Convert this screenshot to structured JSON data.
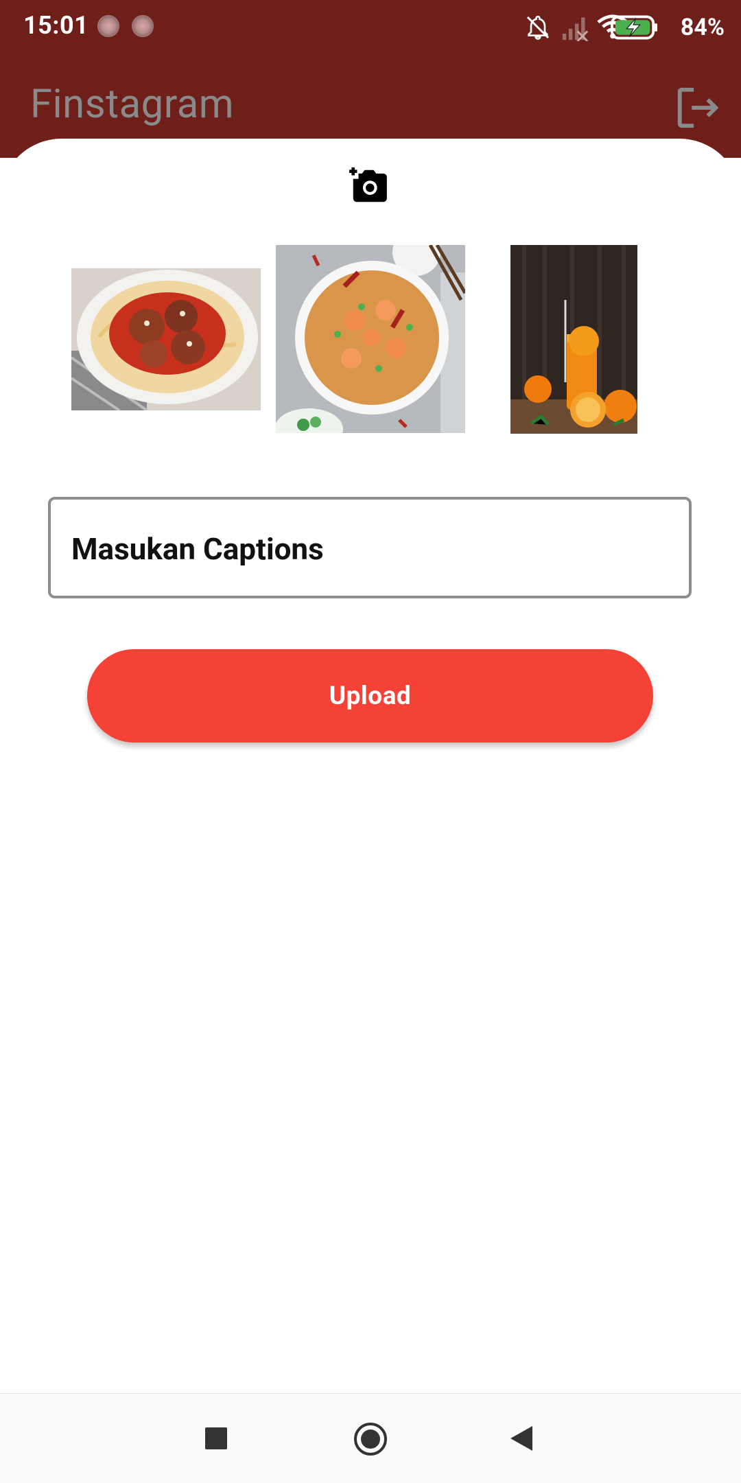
{
  "status_bar": {
    "time": "15:01",
    "battery_percent": "84%",
    "battery_level": 0.84,
    "icons": [
      "notifications-off-icon",
      "signal-icon",
      "wifi-icon",
      "battery-charging-icon"
    ]
  },
  "app_bar": {
    "title": "Finstagram",
    "logout_icon": "logout-icon"
  },
  "upload_form": {
    "add_photo_icon": "add-photo-icon",
    "images": [
      {
        "name": "spaghetti-meatballs-thumbnail"
      },
      {
        "name": "shrimp-fried-rice-thumbnail"
      },
      {
        "name": "orange-juice-thumbnail"
      }
    ],
    "caption_placeholder": "Masukan Captions",
    "upload_label": "Upload"
  },
  "colors": {
    "app_bar_bg": "#6e1f1a",
    "upload_button": "#f44336",
    "title_text": "#8a8a8a"
  },
  "nav_bar": {
    "buttons": [
      "recents-button",
      "home-button",
      "back-button"
    ]
  }
}
